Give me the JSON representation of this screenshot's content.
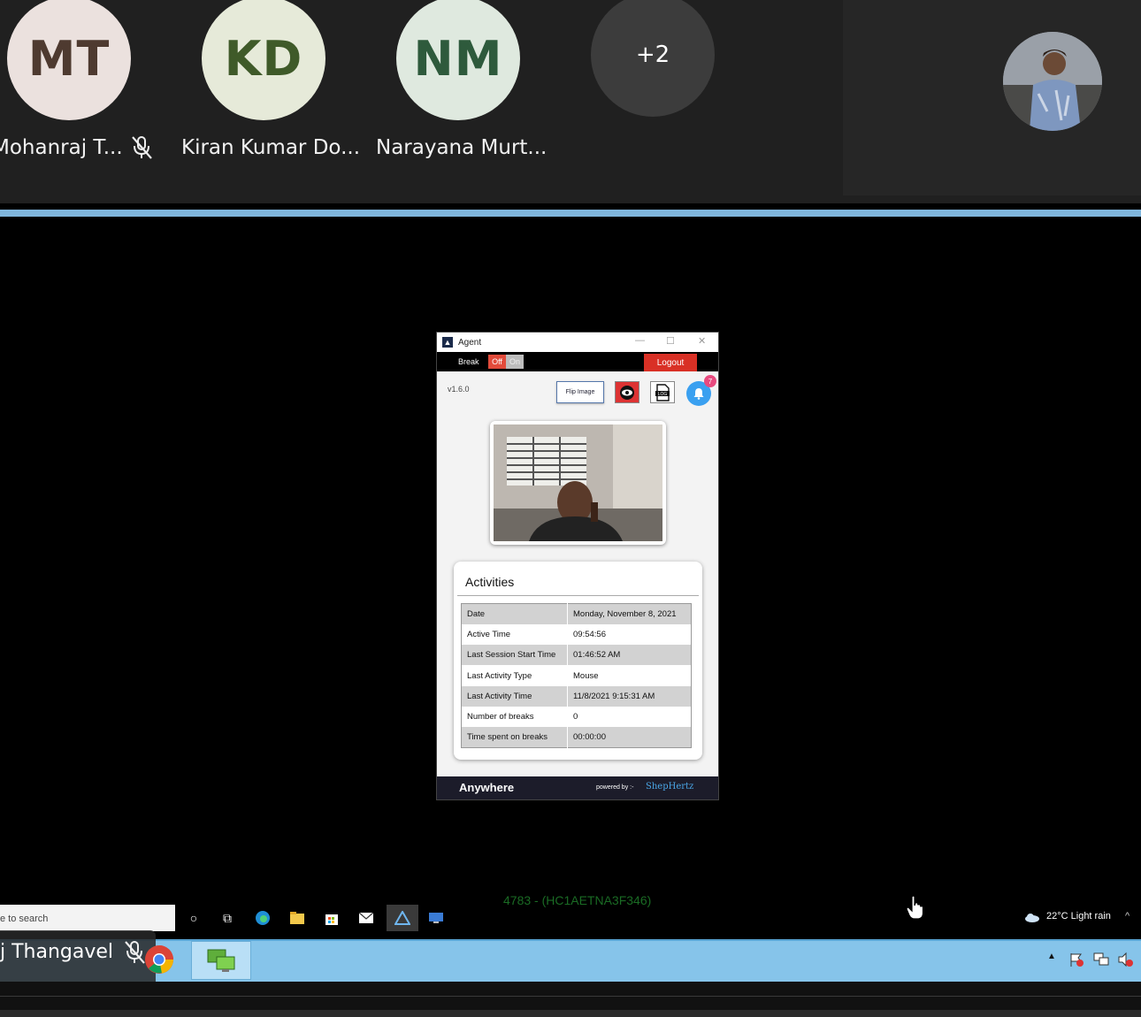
{
  "participants": [
    {
      "initials": "MT",
      "name": "Mohanraj T...",
      "bg": "#ebe1de",
      "fg": "#4e3a30",
      "muted": true
    },
    {
      "initials": "KD",
      "name": "Kiran Kumar Do...",
      "bg": "#e6ead9",
      "fg": "#3f5a29",
      "muted": false
    },
    {
      "initials": "NM",
      "name": "Narayana Murt...",
      "bg": "#dfe9df",
      "fg": "#2e5a3c",
      "muted": false
    }
  ],
  "more_count": "+2",
  "agent": {
    "title": "Agent",
    "break_label": "Break",
    "toggle_off": "Off",
    "toggle_on": "On",
    "logout_label": "Logout",
    "version": "v1.6.0",
    "flip_label": "Flip Image",
    "log_label": "LOG",
    "notification_count": "7",
    "activities_title": "Activities",
    "activities": [
      {
        "key": "Date",
        "value": "Monday, November 8, 2021"
      },
      {
        "key": "Active Time",
        "value": "09:54:56"
      },
      {
        "key": "Last Session Start Time",
        "value": "01:46:52 AM"
      },
      {
        "key": "Last Activity Type",
        "value": "Mouse"
      },
      {
        "key": "Last Activity Time",
        "value": "11/8/2021 9:15:31 AM"
      },
      {
        "key": "Number of breaks",
        "value": "0"
      },
      {
        "key": "Time spent on breaks",
        "value": "00:00:00"
      }
    ],
    "brand": "Anywhere",
    "powered_by": "powered by :-",
    "powered_company": "ShepHertz"
  },
  "remote": {
    "id_text": "4783 - (HC1AETNA3F346)",
    "search_text": "e to search",
    "weather": "22°C  Light rain"
  },
  "local": {
    "presenter_name": "j Thangavel"
  },
  "colors": {
    "accent_blue": "#7fb6dd",
    "logout_red": "#d93025",
    "taskbar_blue": "#86c4ea"
  }
}
